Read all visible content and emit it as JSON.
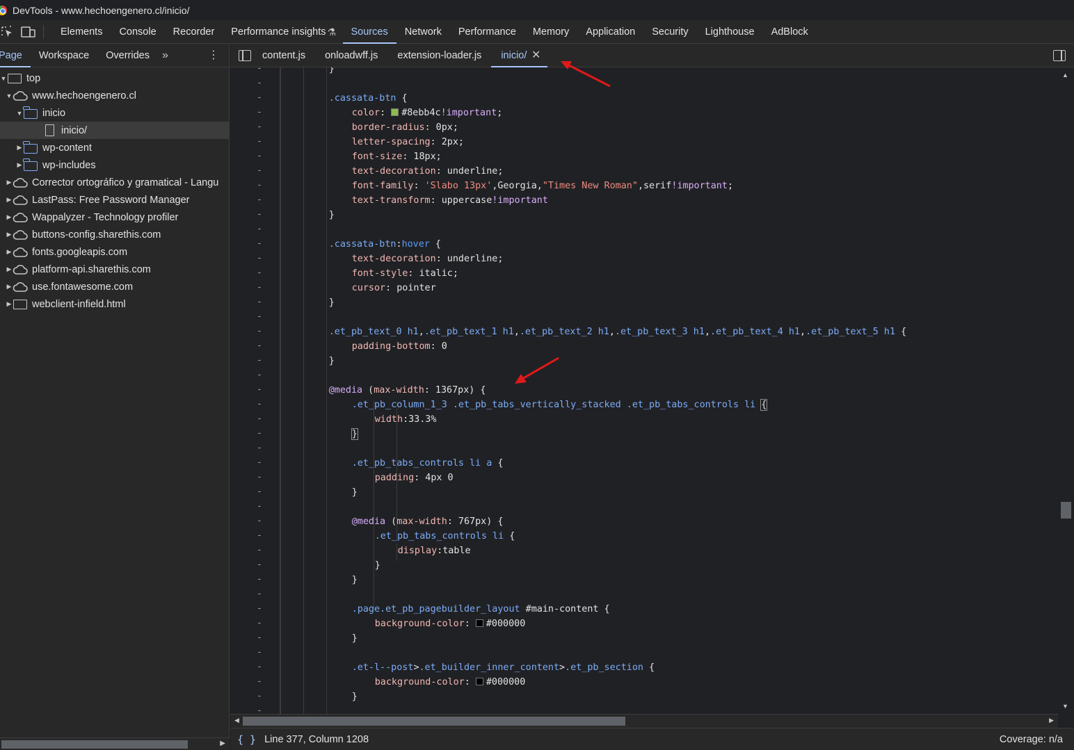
{
  "window": {
    "title": "DevTools - www.hechoengenero.cl/inicio/"
  },
  "main_tabs": [
    {
      "label": "Elements"
    },
    {
      "label": "Console"
    },
    {
      "label": "Recorder"
    },
    {
      "label": "Performance insights"
    },
    {
      "label": "Sources",
      "active": true
    },
    {
      "label": "Network"
    },
    {
      "label": "Performance"
    },
    {
      "label": "Memory"
    },
    {
      "label": "Application"
    },
    {
      "label": "Security"
    },
    {
      "label": "Lighthouse"
    },
    {
      "label": "AdBlock"
    }
  ],
  "navigator": {
    "tabs": [
      {
        "label": "Page",
        "active": true
      },
      {
        "label": "Workspace"
      },
      {
        "label": "Overrides"
      }
    ],
    "tree": [
      {
        "label": "top",
        "icon": "frame-icon",
        "depth": 0,
        "expanded": true
      },
      {
        "label": "www.hechoengenero.cl",
        "icon": "cloud-icon",
        "depth": 1,
        "expanded": true
      },
      {
        "label": "inicio",
        "icon": "folder-icon",
        "depth": 2,
        "expanded": true
      },
      {
        "label": "inicio/",
        "icon": "file-icon",
        "depth": 3,
        "selected": true
      },
      {
        "label": "wp-content",
        "icon": "folder-icon",
        "depth": 2,
        "expanded": false
      },
      {
        "label": "wp-includes",
        "icon": "folder-icon",
        "depth": 2,
        "expanded": false
      },
      {
        "label": "Corrector ortográfico y gramatical - Langu",
        "icon": "cloud-icon",
        "depth": 1,
        "expanded": false
      },
      {
        "label": "LastPass: Free Password Manager",
        "icon": "cloud-icon",
        "depth": 1,
        "expanded": false
      },
      {
        "label": "Wappalyzer - Technology profiler",
        "icon": "cloud-icon",
        "depth": 1,
        "expanded": false
      },
      {
        "label": "buttons-config.sharethis.com",
        "icon": "cloud-icon",
        "depth": 1,
        "expanded": false
      },
      {
        "label": "fonts.googleapis.com",
        "icon": "cloud-icon",
        "depth": 1,
        "expanded": false
      },
      {
        "label": "platform-api.sharethis.com",
        "icon": "cloud-icon",
        "depth": 1,
        "expanded": false
      },
      {
        "label": "use.fontawesome.com",
        "icon": "cloud-icon",
        "depth": 1,
        "expanded": false
      },
      {
        "label": "webclient-infield.html",
        "icon": "frame-icon",
        "depth": 1,
        "expanded": false
      }
    ]
  },
  "editor": {
    "tabs": [
      {
        "label": "content.js"
      },
      {
        "label": "onloadwff.js"
      },
      {
        "label": "extension-loader.js"
      },
      {
        "label": "inicio/",
        "active": true,
        "closable": true
      }
    ],
    "gutter_marker": "-",
    "code": [
      [
        [
          "val",
          "}"
        ]
      ],
      [],
      [
        [
          "sel",
          ".cassata-btn"
        ],
        [
          "val",
          " {"
        ]
      ],
      [
        [
          "prop",
          "color"
        ],
        [
          "val",
          ": "
        ],
        [
          "swatch",
          "#8ebb4c"
        ],
        [
          "val",
          "#8ebb4c"
        ],
        [
          "imp",
          "!important"
        ],
        [
          "val",
          ";"
        ]
      ],
      [
        [
          "prop",
          "border-radius"
        ],
        [
          "val",
          ": 0px;"
        ]
      ],
      [
        [
          "prop",
          "letter-spacing"
        ],
        [
          "val",
          ": 2px;"
        ]
      ],
      [
        [
          "prop",
          "font-size"
        ],
        [
          "val",
          ": 18px;"
        ]
      ],
      [
        [
          "prop",
          "text-decoration"
        ],
        [
          "val",
          ": underline;"
        ]
      ],
      [
        [
          "prop",
          "font-family"
        ],
        [
          "val",
          ": "
        ],
        [
          "str",
          "'Slabo 13px'"
        ],
        [
          "val",
          ",Georgia,"
        ],
        [
          "str",
          "\"Times New Roman\""
        ],
        [
          "val",
          ",serif"
        ],
        [
          "imp",
          "!important"
        ],
        [
          "val",
          ";"
        ]
      ],
      [
        [
          "prop",
          "text-transform"
        ],
        [
          "val",
          ": uppercase"
        ],
        [
          "imp",
          "!important"
        ]
      ],
      [
        [
          "val",
          "}"
        ]
      ],
      [],
      [
        [
          "sel",
          ".cassata-btn"
        ],
        [
          "val",
          ":"
        ],
        [
          "pseudo",
          "hover"
        ],
        [
          "val",
          " {"
        ]
      ],
      [
        [
          "prop",
          "text-decoration"
        ],
        [
          "val",
          ": underline;"
        ]
      ],
      [
        [
          "prop",
          "font-style"
        ],
        [
          "val",
          ": italic;"
        ]
      ],
      [
        [
          "prop",
          "cursor"
        ],
        [
          "val",
          ": pointer"
        ]
      ],
      [
        [
          "val",
          "}"
        ]
      ],
      [],
      [
        [
          "sel",
          ".et_pb_text_0 h1"
        ],
        [
          "val",
          ","
        ],
        [
          "sel",
          ".et_pb_text_1 h1"
        ],
        [
          "val",
          ","
        ],
        [
          "sel",
          ".et_pb_text_2 h1"
        ],
        [
          "val",
          ","
        ],
        [
          "sel",
          ".et_pb_text_3 h1"
        ],
        [
          "val",
          ","
        ],
        [
          "sel",
          ".et_pb_text_4 h1"
        ],
        [
          "val",
          ","
        ],
        [
          "sel",
          ".et_pb_text_5 h1"
        ],
        [
          "val",
          " {"
        ]
      ],
      [
        [
          "prop",
          "padding-bottom"
        ],
        [
          "val",
          ": 0"
        ]
      ],
      [
        [
          "val",
          "}"
        ]
      ],
      [],
      [
        [
          "kw",
          "@media"
        ],
        [
          "val",
          " ("
        ],
        [
          "prop",
          "max-width"
        ],
        [
          "val",
          ": 1367px) {"
        ]
      ],
      [
        [
          "sel",
          ".et_pb_column_1_3 .et_pb_tabs_vertically_stacked .et_pb_tabs_controls li"
        ],
        [
          "val",
          " "
        ],
        [
          "hl",
          "{"
        ]
      ],
      [
        [
          "prop",
          "width"
        ],
        [
          "val",
          ":33.3%"
        ]
      ],
      [
        [
          "hl",
          "}"
        ]
      ],
      [],
      [
        [
          "sel",
          ".et_pb_tabs_controls li a"
        ],
        [
          "val",
          " {"
        ]
      ],
      [
        [
          "prop",
          "padding"
        ],
        [
          "val",
          ": 4px 0"
        ]
      ],
      [
        [
          "val",
          "}"
        ]
      ],
      [],
      [
        [
          "kw",
          "@media"
        ],
        [
          "val",
          " ("
        ],
        [
          "prop",
          "max-width"
        ],
        [
          "val",
          ": 767px) {"
        ]
      ],
      [
        [
          "sel",
          ".et_pb_tabs_controls li"
        ],
        [
          "val",
          " {"
        ]
      ],
      [
        [
          "prop",
          "display"
        ],
        [
          "val",
          ":table"
        ]
      ],
      [
        [
          "val",
          "}"
        ]
      ],
      [
        [
          "val",
          "}"
        ]
      ],
      [],
      [
        [
          "sel",
          ".page.et_pb_pagebuilder_layout"
        ],
        [
          "val",
          " #main-content {"
        ]
      ],
      [
        [
          "prop",
          "background-color"
        ],
        [
          "val",
          ": "
        ],
        [
          "swatch",
          "#000000"
        ],
        [
          "val",
          "#000000"
        ]
      ],
      [
        [
          "val",
          "}"
        ]
      ],
      [],
      [
        [
          "sel",
          ".et-l--post"
        ],
        [
          "val",
          ">"
        ],
        [
          "sel",
          ".et_builder_inner_content"
        ],
        [
          "val",
          ">"
        ],
        [
          "sel",
          ".et_pb_section"
        ],
        [
          "val",
          " {"
        ]
      ],
      [
        [
          "prop",
          "background-color"
        ],
        [
          "val",
          ": "
        ],
        [
          "swatch",
          "#000000"
        ],
        [
          "val",
          "#000000"
        ]
      ],
      [
        [
          "val",
          "}"
        ]
      ],
      []
    ]
  },
  "status": {
    "position": "Line 377, Column 1208",
    "coverage": "Coverage: n/a"
  },
  "colors": {
    "accent": "#a8c7fa",
    "annotation_arrow": "#e11919"
  }
}
